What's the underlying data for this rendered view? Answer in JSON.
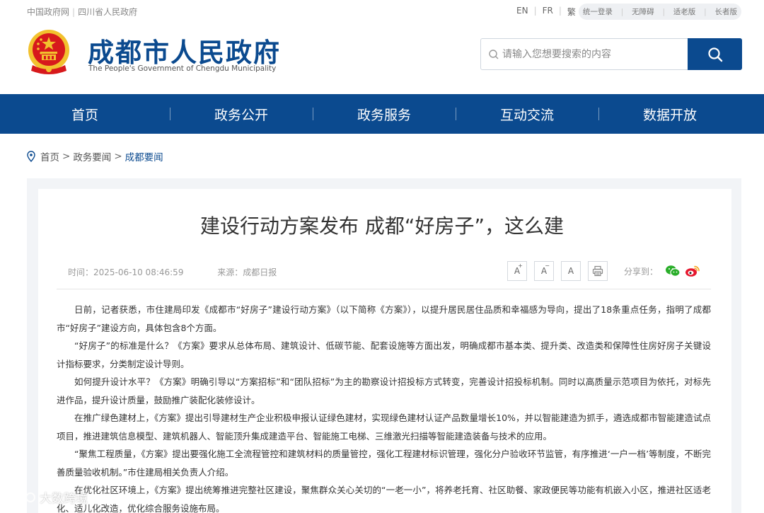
{
  "topbar": {
    "links": [
      "中国政府网",
      "四川省人民政府"
    ],
    "languages": [
      "EN",
      "FR",
      "繁"
    ],
    "modes": [
      "统一登录",
      "无障碍",
      "适老版",
      "长者版"
    ]
  },
  "header": {
    "site_title": "成都市人民政府",
    "site_subtitle": "The People's Government of Chengdu Municipality",
    "search_placeholder": "请输入您想要搜索的内容"
  },
  "nav": [
    "首页",
    "政务公开",
    "政务服务",
    "互动交流",
    "数据开放"
  ],
  "breadcrumb": {
    "home": "首页",
    "level2": "政务要闻",
    "current": "成都要闻",
    "sep": ">"
  },
  "article": {
    "title": "建设行动方案发布 成都“好房子”，这么建",
    "time": "时间：2025-06-10 08:46:59",
    "source": "来源：成都日报",
    "tools": {
      "font_larger": "A",
      "font_larger_mark": "+",
      "font_smaller": "A",
      "font_smaller_mark": "−",
      "font_reset": "A"
    },
    "share_label": "分享到：",
    "paragraphs": [
      "日前，记者获悉，市住建局印发《成都市“好房子”建设行动方案》（以下简称《方案》），以提升居民居住品质和幸福感为导向，提出了18条重点任务，指明了成都市“好房子”建设方向，具体包含8个方面。",
      "“好房子”的标准是什么？《方案》要求从总体布局、建筑设计、低碳节能、配套设施等方面出发，明确成都市基本类、提升类、改造类和保障性住房好房子关键设计指标要求，分类制定设计导则。",
      "如何提升设计水平？《方案》明确引导以“方案招标”和“团队招标”为主的勘察设计招投标方式转变，完善设计招投标机制。同时以高质量示范项目为依托，对标先进作品，提升设计质量，鼓励推广装配化装修设计。",
      "在推广绿色建材上，《方案》提出引导建材生产企业积极申报认证绿色建材，实现绿色建材认证产品数量增长10%，并以智能建造为抓手，遴选成都市智能建造试点项目，推进建筑信息模型、建筑机器人、智能顶升集成建造平台、智能施工电梯、三维激光扫描等智能建造装备与技术的应用。",
      "“聚焦工程质量，《方案》提出要强化施工全流程管控和建筑材料的质量管控，强化工程建材标识管理，强化分户验收环节监管，有序推进‘一户一档’等制度，不断完善质量验收机制。”市住建局相关负责人介绍。",
      "在优化社区环境上，《方案》提出统筹推进完整社区建设，聚焦群众关心关切的“一老一小”，将养老托育、社区助餐、家政便民等功能有机嵌入小区，推进社区适老化、适儿化改造，优化综合服务设施布局。"
    ]
  },
  "watermark": "大数跨境",
  "colors": {
    "brand": "#0b4a8f",
    "emblem_red": "#d7191c",
    "emblem_gold": "#f2c12e"
  }
}
